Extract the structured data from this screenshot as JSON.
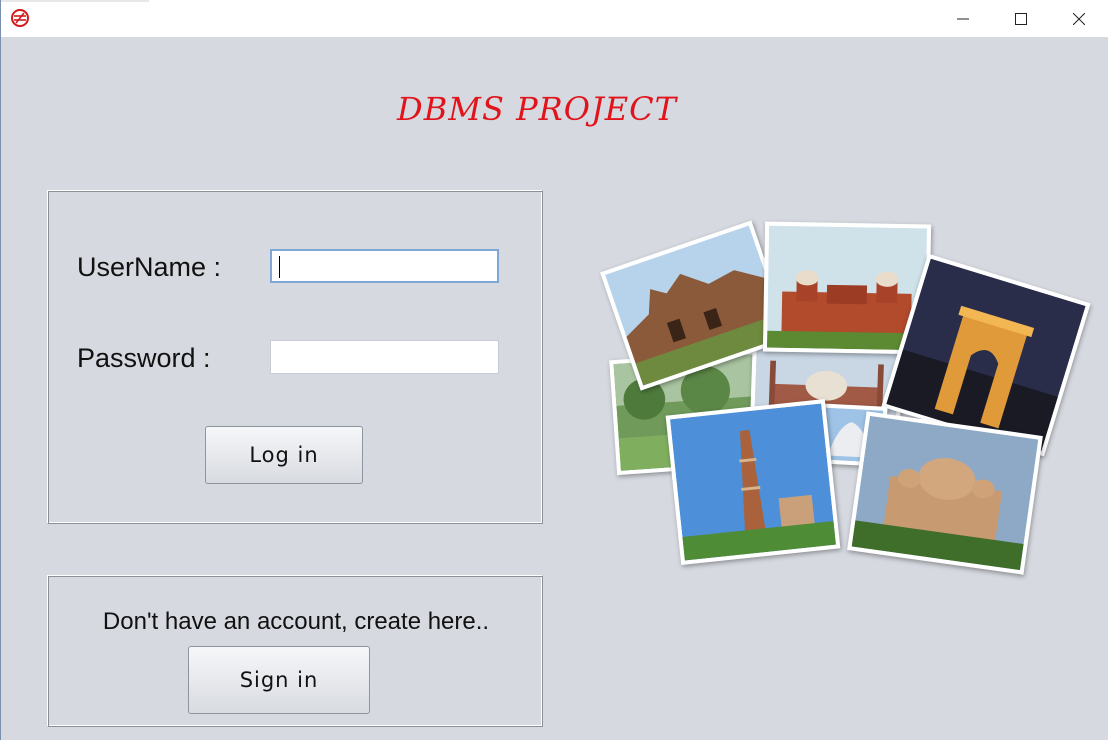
{
  "window": {
    "app_icon": "metro-logo-icon",
    "controls": {
      "minimize": "minimize-icon",
      "maximize": "maximize-icon",
      "close": "close-icon"
    }
  },
  "header": {
    "title": "DBMS PROJECT"
  },
  "login": {
    "username_label": "UserName :",
    "username_value": "",
    "password_label": "Password :",
    "password_value": "",
    "login_button": "Log in"
  },
  "signup": {
    "prompt": "Don't have an account, create here..",
    "signin_button": "Sign in"
  },
  "collage": {
    "photos": [
      "purana-qila",
      "red-fort",
      "india-gate",
      "park",
      "jama-masjid",
      "lotus-temple",
      "qutub-minar",
      "akshardham"
    ]
  },
  "colors": {
    "background": "#d6d9e0",
    "title": "#e0141a",
    "input_focus_border": "#7fa7d6"
  }
}
